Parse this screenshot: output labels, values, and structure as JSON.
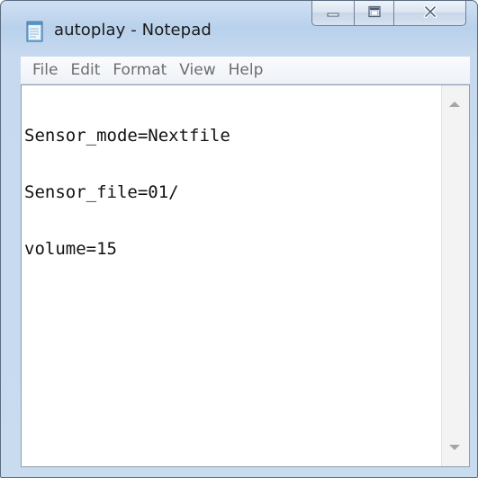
{
  "window": {
    "title": "autoplay - Notepad",
    "app_icon": "notepad-icon",
    "colors": {
      "frame": "#c6d9ef",
      "text_area": "#ffffff",
      "menu_text": "#6d6d6d"
    }
  },
  "caption_buttons": {
    "minimize_icon": "minimize-icon",
    "maximize_icon": "maximize-icon",
    "close_icon": "close-icon"
  },
  "menu": {
    "items": [
      {
        "label": "File"
      },
      {
        "label": "Edit"
      },
      {
        "label": "Format"
      },
      {
        "label": "View"
      },
      {
        "label": "Help"
      }
    ]
  },
  "editor": {
    "lines": [
      "Sensor_mode=Nextfile",
      "Sensor_file=01/",
      "volume=15"
    ]
  },
  "scrollbar": {
    "up_icon": "scroll-up-arrow-icon",
    "down_icon": "scroll-down-arrow-icon"
  }
}
